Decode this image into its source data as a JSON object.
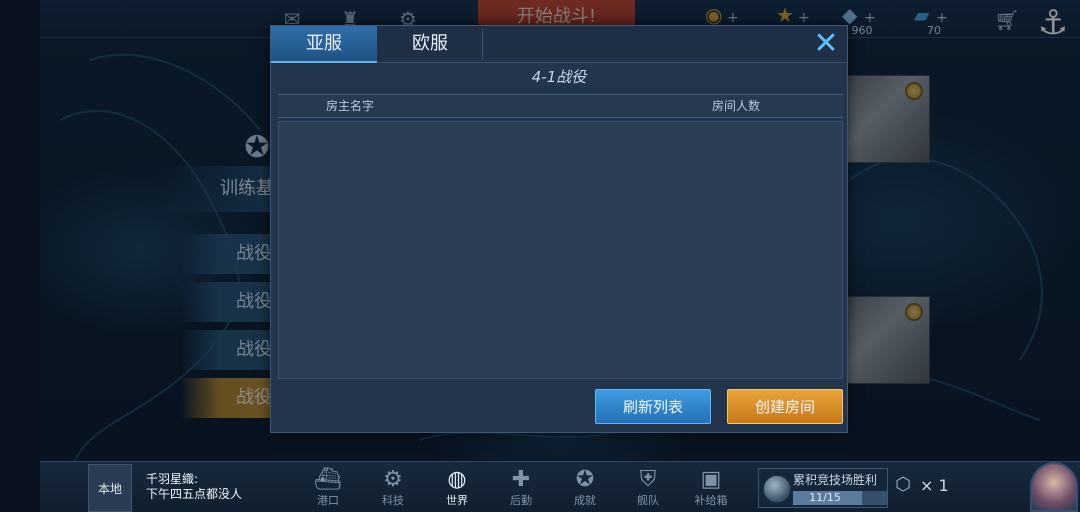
{
  "topbar": {
    "start_battle": "开始战斗!",
    "icons": [
      "mail-icon",
      "crew-icon",
      "gear-icon"
    ],
    "resources": [
      {
        "name": "gold",
        "glyph": "◉",
        "color": "#d9a52c",
        "value": ""
      },
      {
        "name": "star",
        "glyph": "★",
        "color": "#d8a83a",
        "value": ""
      },
      {
        "name": "diamond",
        "glyph": "◆",
        "color": "#8fc8ef",
        "value": "960"
      },
      {
        "name": "ship-token",
        "glyph": "▰",
        "color": "#4aa6e6",
        "value": "70"
      }
    ]
  },
  "left_menu": {
    "training": "训练基",
    "items": [
      "战役",
      "战役",
      "战役",
      "战役"
    ]
  },
  "modal": {
    "tabs": [
      {
        "label": "亚服",
        "active": true
      },
      {
        "label": "欧服",
        "active": false
      }
    ],
    "subtitle": "4-1战役",
    "columns": {
      "host_name": "房主名字",
      "room_count": "房间人数"
    },
    "rooms": [],
    "refresh_label": "刷新列表",
    "create_label": "创建房间"
  },
  "bottombar": {
    "chat_channel": "本地",
    "chat_sender": "千羽星織:",
    "chat_text": "下午四五点都没人",
    "nav": [
      {
        "label": "港口",
        "icon": "harbor-icon",
        "glyph": "⛴",
        "active": false
      },
      {
        "label": "科技",
        "icon": "tech-icon",
        "glyph": "⚙",
        "active": false
      },
      {
        "label": "世界",
        "icon": "globe-icon",
        "glyph": "◍",
        "active": true
      },
      {
        "label": "后勤",
        "icon": "logistics-icon",
        "glyph": "✚",
        "active": false
      },
      {
        "label": "成就",
        "icon": "achievement-icon",
        "glyph": "✪",
        "active": false
      },
      {
        "label": "舰队",
        "icon": "fleet-icon",
        "glyph": "⛨",
        "active": false
      },
      {
        "label": "补给箱",
        "icon": "supply-box-icon",
        "glyph": "▣",
        "active": false
      }
    ],
    "arena": {
      "title": "累积竞技场胜利",
      "progress": "11/15",
      "progress_fraction": 0.7333
    },
    "chip_count": "× 1"
  },
  "colors": {
    "accent_blue": "#2f6ea8",
    "close_blue": "#5cc0ff",
    "button_orange": "#c67a18",
    "start_red": "#c9472f"
  }
}
